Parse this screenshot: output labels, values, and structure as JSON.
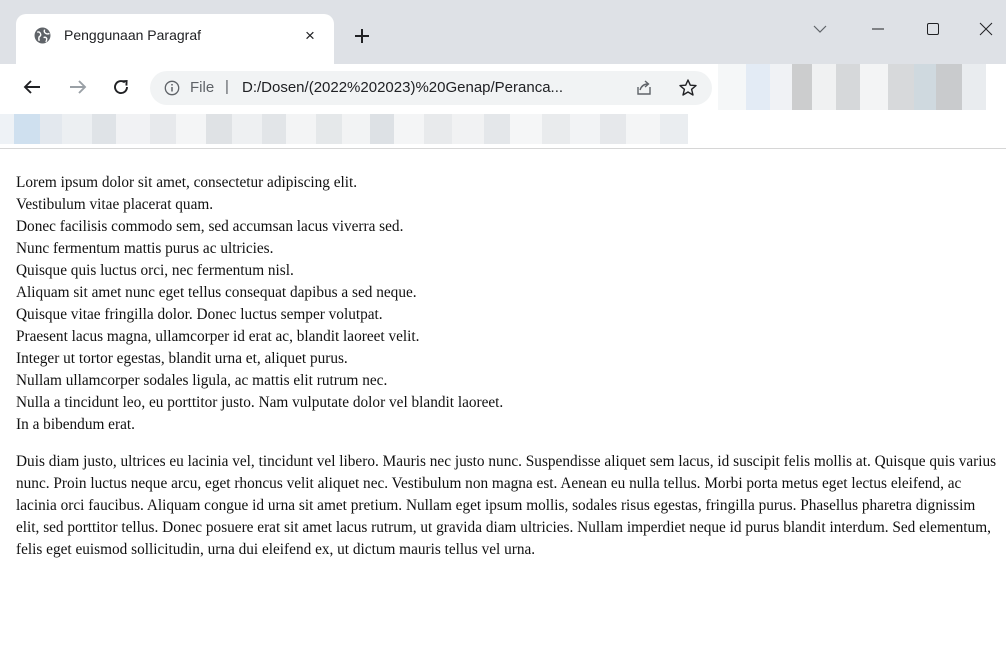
{
  "browser": {
    "tab": {
      "title": "Penggunaan Paragraf",
      "close_glyph": "×",
      "favicon": "globe-icon"
    },
    "new_tab_icon": "plus-icon",
    "window_controls": [
      "chevron-down-icon",
      "minimize-icon",
      "maximize-icon",
      "close-icon"
    ],
    "toolbar": {
      "back_icon": "arrow-left-icon",
      "forward_icon": "arrow-right-icon",
      "reload_icon": "reload-icon",
      "address": {
        "scheme_label": "File",
        "separator": "|",
        "url": "D:/Dosen/(2022%202023)%20Genap/Peranca...",
        "info_icon": "info-icon",
        "share_icon": "share-icon",
        "bookmark_icon": "star-icon"
      }
    },
    "colors": {
      "tabstrip": "#dee1e6",
      "omnibox": "#f1f3f4"
    }
  },
  "page": {
    "paragraph1_lines": [
      "Lorem ipsum dolor sit amet, consectetur adipiscing elit.",
      "Vestibulum vitae placerat quam.",
      "Donec facilisis commodo sem, sed accumsan lacus viverra sed.",
      "Nunc fermentum mattis purus ac ultricies.",
      "Quisque quis luctus orci, nec fermentum nisl.",
      "Aliquam sit amet nunc eget tellus consequat dapibus a sed neque.",
      "Quisque vitae fringilla dolor. Donec luctus semper volutpat.",
      "Praesent lacus magna, ullamcorper id erat ac, blandit laoreet velit.",
      "Integer ut tortor egestas, blandit urna et, aliquet purus.",
      "Nullam ullamcorper sodales ligula, ac mattis elit rutrum nec.",
      "Nulla a tincidunt leo, eu porttitor justo. Nam vulputate dolor vel blandit laoreet.",
      "In a bibendum erat."
    ],
    "paragraph2": "Duis diam justo, ultrices eu lacinia vel, tincidunt vel libero. Mauris nec justo nunc. Suspendisse aliquet sem lacus, id suscipit felis mollis at. Quisque quis varius nunc. Proin luctus neque arcu, eget rhoncus velit aliquet nec. Vestibulum non magna est. Aenean eu nulla tellus. Morbi porta metus eget lectus eleifend, ac lacinia orci faucibus. Aliquam congue id urna sit amet pretium. Nullam eget ipsum mollis, sodales risus egestas, fringilla purus. Phasellus pharetra dignissim elit, sed porttitor tellus. Donec posuere erat sit amet lacus rutrum, ut gravida diam ultricies. Nullam imperdiet neque id purus blandit interdum. Sed elementum, felis eget euismod sollicitudin, urna dui eleifend ex, ut dictum mauris tellus vel urna."
  }
}
